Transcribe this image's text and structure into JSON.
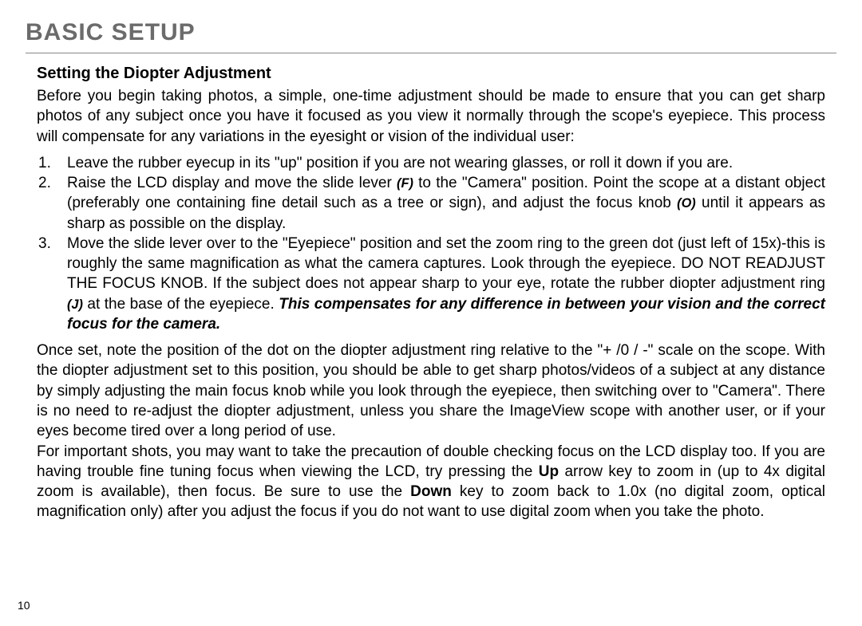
{
  "chapter_title": "BASIC SETUP",
  "section_title": "Setting the Diopter Adjustment",
  "intro": "Before you begin taking photos, a simple, one-time adjustment should be made to ensure that you can get sharp photos of any subject once you have it focused as you view it normally through the scope's eyepiece. This process will compensate for any variations in the eyesight or vision of the individual user:",
  "steps": [
    {
      "num": "1.",
      "text": "Leave the rubber eyecup in its \"up\" position if you are not wearing glasses, or roll it down if you are."
    },
    {
      "num": "2.",
      "pre1": "Raise the LCD display and move the slide lever ",
      "ref1": "(F)",
      "mid1": " to the \"Camera\" position. Point the scope at a distant object (preferably one containing fine detail such as a tree or sign), and adjust the focus knob ",
      "ref2": "(O)",
      "post1": " until it appears as sharp as possible on the display."
    },
    {
      "num": "3.",
      "pre1": "Move the slide lever over to the \"Eyepiece\" position and set the zoom ring to the green dot (just left of 15x)-this is roughly the same magnification as what the camera captures. Look through the eyepiece. DO NOT READJUST THE FOCUS KNOB. If the subject does not appear sharp to your eye, rotate the rubber diopter adjustment ring ",
      "ref1": "(J)",
      "mid1": " at the base of the eyepiece. ",
      "emph": "This compensates for any difference in between your vision and the correct focus for the camera."
    }
  ],
  "p1": "Once set, note the position of the dot on the diopter adjustment ring relative to the \"+ /0 / -\" scale on the scope. With the diopter adjustment set to this position, you should be able to get sharp photos/videos of a subject at any distance by simply adjusting the main focus knob while you look through the eyepiece, then switching over to \"Camera\". There is no need to re-adjust the diopter adjustment, unless you share the ImageView scope with another user, or if your eyes become tired over a long period of use.",
  "p2_pre": "For important shots, you may want to take the precaution of double checking focus on the LCD display too. If you are having trouble fine tuning focus when viewing the LCD, try pressing the ",
  "p2_b1": "Up",
  "p2_mid1": " arrow key to zoom in (up to 4x digital zoom is available), then focus. Be sure to use the ",
  "p2_b2": "Down",
  "p2_post": " key to zoom back to 1.0x (no digital zoom, optical magnification only) after you adjust the focus if you do not want to use digital zoom when you take the photo.",
  "page_number": "10"
}
